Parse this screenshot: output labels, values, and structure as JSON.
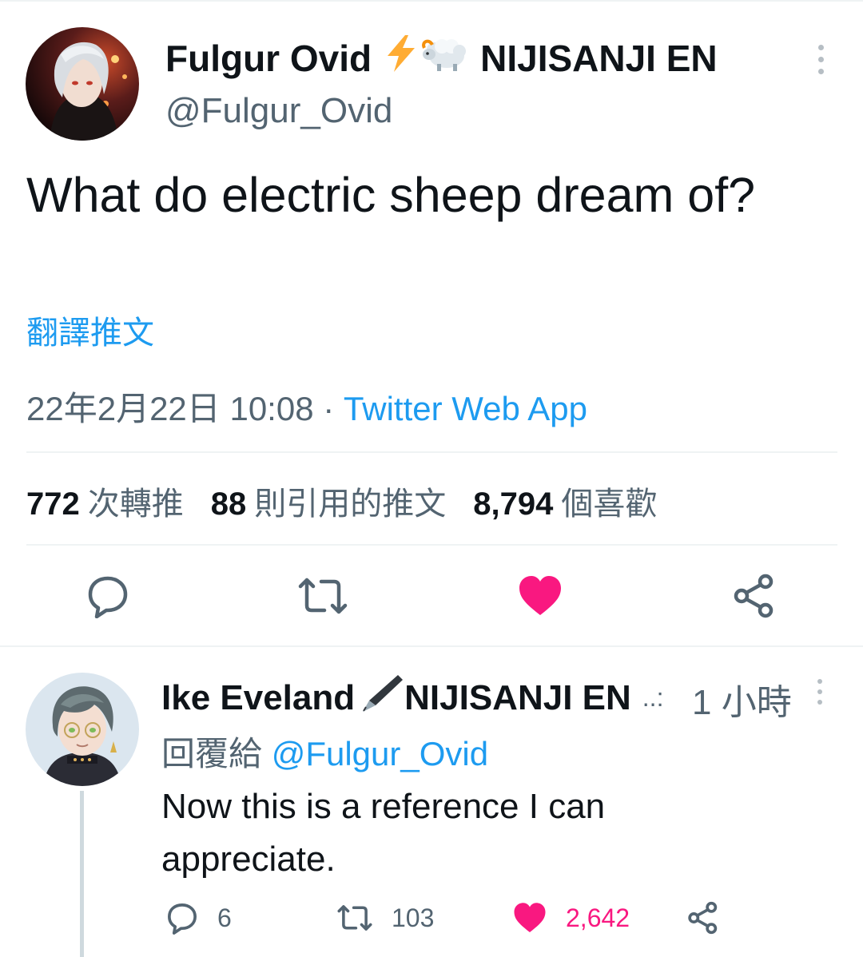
{
  "tweet": {
    "author_name": "Fulgur Ovid",
    "author_suffix": "NIJISANJI EN",
    "author_emoji": "⚡",
    "handle": "@Fulgur_Ovid",
    "text": "What do electric sheep dream of?",
    "translate_label": "翻譯推文",
    "timestamp": "22年2月22日 10:08",
    "separator": " · ",
    "source_app": "Twitter Web App",
    "stats": {
      "retweets_count": "772",
      "retweets_label": "次轉推",
      "quotes_count": "88",
      "quotes_label": "則引用的推文",
      "likes_count": "8,794",
      "likes_label": "個喜歡"
    },
    "liked": true
  },
  "reply": {
    "author_name": "Ike Eveland",
    "author_suffix": "NIJISANJI EN",
    "name_trail": "..:",
    "time": "1 小時",
    "replying_prefix": "回覆給",
    "replying_to": "@Fulgur_Ovid",
    "text": "Now this is a reference I can appreciate.",
    "reply_count": "6",
    "retweet_count": "103",
    "like_count": "2,642"
  },
  "colors": {
    "accent": "#1d9bf0",
    "like": "#f91880",
    "muted": "#536471",
    "text": "#0f1419"
  }
}
